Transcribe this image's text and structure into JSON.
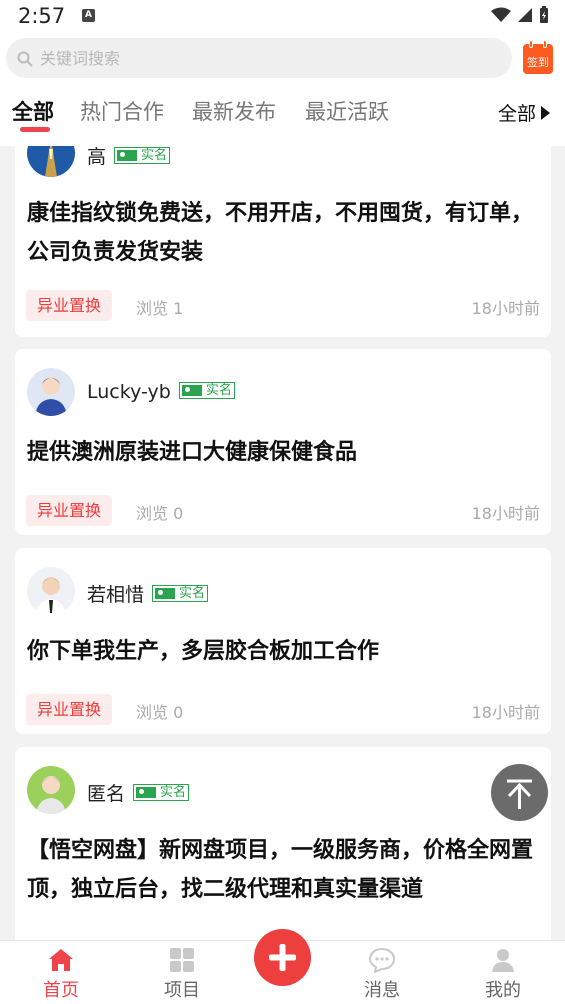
{
  "status_bar": {
    "time": "2:57",
    "notification_letter": "A"
  },
  "search": {
    "placeholder": "关键词搜索",
    "sign_in_label": "签到"
  },
  "tabs": [
    {
      "label": "全部",
      "active": true
    },
    {
      "label": "热门合作",
      "active": false
    },
    {
      "label": "最新发布",
      "active": false
    },
    {
      "label": "最近活跃",
      "active": false
    }
  ],
  "filter": {
    "label": "全部"
  },
  "verified_label": "实名",
  "posts": [
    {
      "user": "高",
      "title": "康佳指纹锁免费送，不用开店，不用囤货，有订单，公司负责发货安装",
      "tag": "异业置换",
      "views": "浏览 1",
      "time": "18小时前"
    },
    {
      "user": "Lucky-yb",
      "title": "提供澳洲原装进口大健康保健食品",
      "tag": "异业置换",
      "views": "浏览 0",
      "time": "18小时前"
    },
    {
      "user": "若相惜",
      "title": "你下单我生产，多层胶合板加工合作",
      "tag": "异业置换",
      "views": "浏览 0",
      "time": "18小时前"
    },
    {
      "user": "匿名",
      "title": "【悟空网盘】新网盘项目，一级服务商，价格全网置顶，独立后台，找二级代理和真实量渠道"
    }
  ],
  "bottom_nav": [
    {
      "label": "首页",
      "icon": "home-icon",
      "active": true
    },
    {
      "label": "项目",
      "icon": "grid-icon",
      "active": false
    },
    {
      "label": "消息",
      "icon": "chat-icon",
      "active": false
    },
    {
      "label": "我的",
      "icon": "person-icon",
      "active": false
    }
  ],
  "colors": {
    "accent": "#f0444c",
    "verified": "#2aa44f",
    "tag_bg": "#fdecec",
    "sign_in": "#ff5a1f"
  }
}
